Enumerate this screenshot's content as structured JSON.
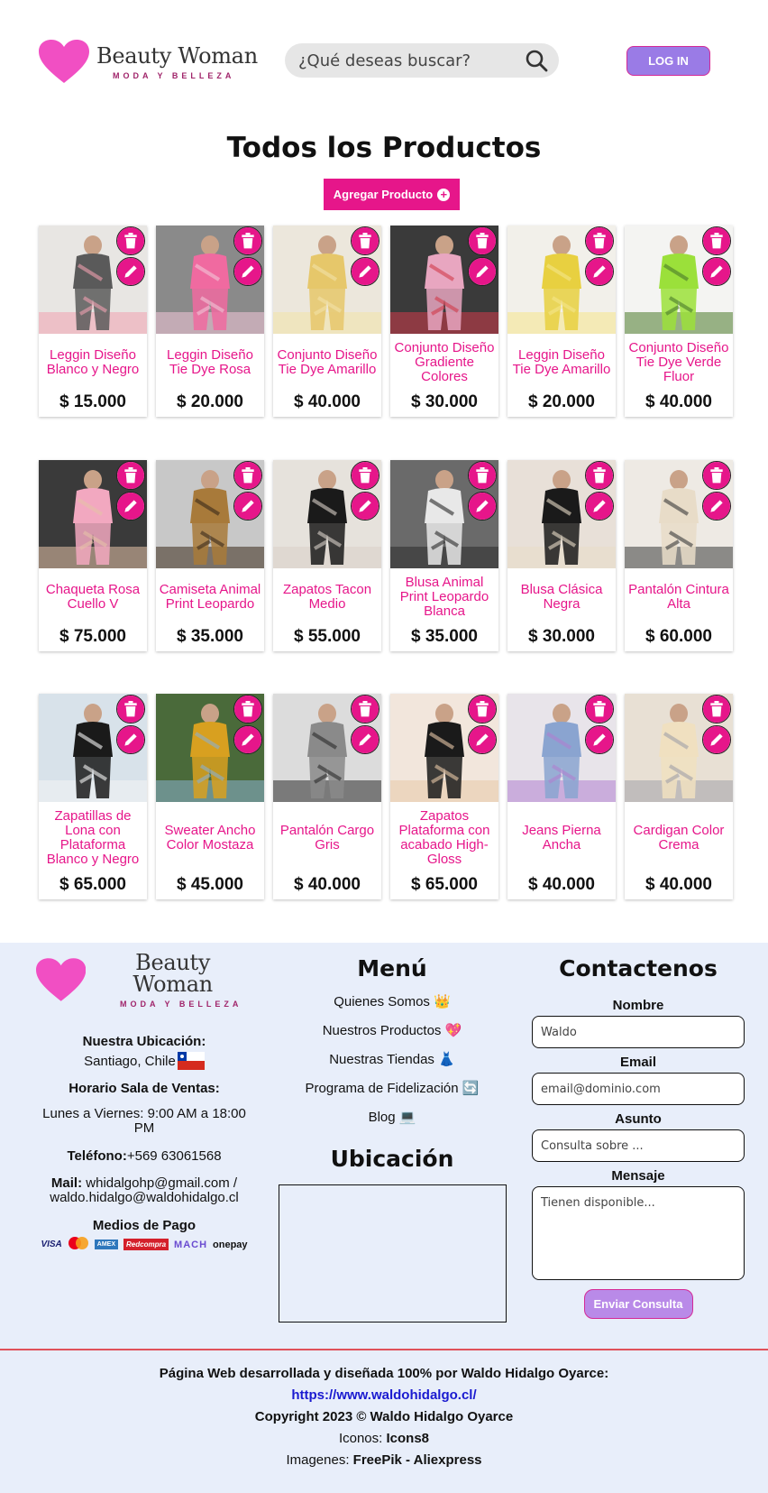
{
  "header": {
    "brand": "Beauty Woman",
    "tagline": "MODA Y BELLEZA",
    "search_placeholder": "¿Qué deseas buscar?",
    "login_label": "LOG IN"
  },
  "main": {
    "title": "Todos los Productos",
    "add_button": "Agregar Producto",
    "products": [
      {
        "name": "Leggin Diseño Blanco y Negro",
        "price": "$ 15.000",
        "colors": [
          "#e8e6e3",
          "#5a5a5a",
          "#f0a0b0"
        ]
      },
      {
        "name": "Leggin Diseño Tie Dye Rosa",
        "price": "$ 20.000",
        "colors": [
          "#8a8a8a",
          "#f06aa0",
          "#f2c6d8"
        ]
      },
      {
        "name": "Conjunto Diseño Tie Dye Amarillo",
        "price": "$ 40.000",
        "colors": [
          "#ece7dc",
          "#e6c76a",
          "#f3e3a8"
        ]
      },
      {
        "name": "Conjunto Diseño Gradiente Colores",
        "price": "$ 30.000",
        "colors": [
          "#3a3a3a",
          "#e8a6c0",
          "#d23a4a"
        ]
      },
      {
        "name": "Leggin Diseño Tie Dye Amarillo",
        "price": "$ 20.000",
        "colors": [
          "#f2f0ea",
          "#e8d040",
          "#f5e68a"
        ]
      },
      {
        "name": "Conjunto Diseño Tie Dye Verde Fluor",
        "price": "$ 40.000",
        "colors": [
          "#f4f4f2",
          "#9be03a",
          "#4a7a2a"
        ]
      },
      {
        "name": "Chaqueta Rosa Cuello V",
        "price": "$ 75.000",
        "colors": [
          "#3a3a3a",
          "#f2a8c0",
          "#e6c2a8"
        ]
      },
      {
        "name": "Camiseta Animal Print Leopardo",
        "price": "$ 35.000",
        "colors": [
          "#c8c8c8",
          "#a87a3a",
          "#3a2a1a"
        ]
      },
      {
        "name": "Zapatos Tacon Medio",
        "price": "$ 55.000",
        "colors": [
          "#e6e2dc",
          "#1a1a1a",
          "#d8d0c8"
        ]
      },
      {
        "name": "Blusa Animal Print Leopardo Blanca",
        "price": "$ 35.000",
        "colors": [
          "#6a6a6a",
          "#e8e8e8",
          "#2a2a2a"
        ]
      },
      {
        "name": "Blusa Clásica Negra",
        "price": "$ 30.000",
        "colors": [
          "#e8e0d8",
          "#1a1a1a",
          "#e8dcc8"
        ]
      },
      {
        "name": "Pantalón Cintura Alta",
        "price": "$ 60.000",
        "colors": [
          "#eeeae4",
          "#e8dcc8",
          "#3a3a3a"
        ]
      },
      {
        "name": "Zapatillas de Lona con Plataforma Blanco y Negro",
        "price": "$ 65.000",
        "colors": [
          "#d8e2ea",
          "#1a1a1a",
          "#f4f4f4"
        ]
      },
      {
        "name": "Sweater Ancho Color Mostaza",
        "price": "$ 45.000",
        "colors": [
          "#4a6a3a",
          "#d8a020",
          "#8ab0d0"
        ]
      },
      {
        "name": "Pantalón Cargo Gris",
        "price": "$ 40.000",
        "colors": [
          "#dcdcdc",
          "#8a8a8a",
          "#2a2a2a"
        ]
      },
      {
        "name": "Zapatos Plataforma con acabado High-Gloss",
        "price": "$ 65.000",
        "colors": [
          "#f2e6dc",
          "#1a1a1a",
          "#e8c8a8"
        ]
      },
      {
        "name": "Jeans Pierna Ancha",
        "price": "$ 40.000",
        "colors": [
          "#e8e4ea",
          "#8aa4d0",
          "#b080d0"
        ]
      },
      {
        "name": "Cardigan Color Crema",
        "price": "$ 40.000",
        "colors": [
          "#e8e0d4",
          "#f0e0c0",
          "#a0a0a8"
        ]
      }
    ]
  },
  "footer": {
    "brand": "Beauty Woman",
    "tagline": "MODA Y BELLEZA",
    "location_label": "Nuestra Ubicación:",
    "location_value": "Santiago, Chile",
    "hours_label": "Horario Sala de Ventas:",
    "hours_value": "Lunes a Viernes: 9:00 AM a 18:00 PM",
    "phone_label": "Teléfono:",
    "phone_value": "+569 63061568",
    "mail_label": "Mail:",
    "mail_value": "whidalgohp@gmail.com / waldo.hidalgo@waldohidalgo.cl",
    "payment_label": "Medios de Pago",
    "payment_methods": [
      "VISA",
      "Mastercard",
      "AMEX",
      "Redcompra",
      "MACH",
      "onepay"
    ],
    "menu_title": "Menú",
    "menu_items": [
      "Quienes Somos 👑",
      "Nuestros Productos 💖",
      "Nuestras Tiendas 👗",
      "Programa de Fidelización 🔄",
      "Blog 💻"
    ],
    "map_title": "Ubicación",
    "contact_title": "Contactenos",
    "form": {
      "name_label": "Nombre",
      "name_value": "Waldo",
      "email_label": "Email",
      "email_placeholder": "email@dominio.com",
      "subject_label": "Asunto",
      "subject_placeholder": "Consulta sobre ...",
      "message_label": "Mensaje",
      "message_placeholder": "Tienen disponible...",
      "send_label": "Enviar Consulta"
    },
    "credits": {
      "line1": "Página Web desarrollada y diseñada 100% por Waldo Hidalgo Oyarce:",
      "link": "https://www.waldohidalgo.cl/",
      "copyright": "Copyright 2023 © Waldo Hidalgo Oyarce",
      "icons_label": "Iconos:",
      "icons_value": "Icons8",
      "images_label": "Imagenes:",
      "images_value": "FreePik - Aliexpress"
    }
  },
  "colors": {
    "accent": "#e6168a",
    "login": "#9a7be6",
    "footer_bg": "#e8eefa"
  }
}
